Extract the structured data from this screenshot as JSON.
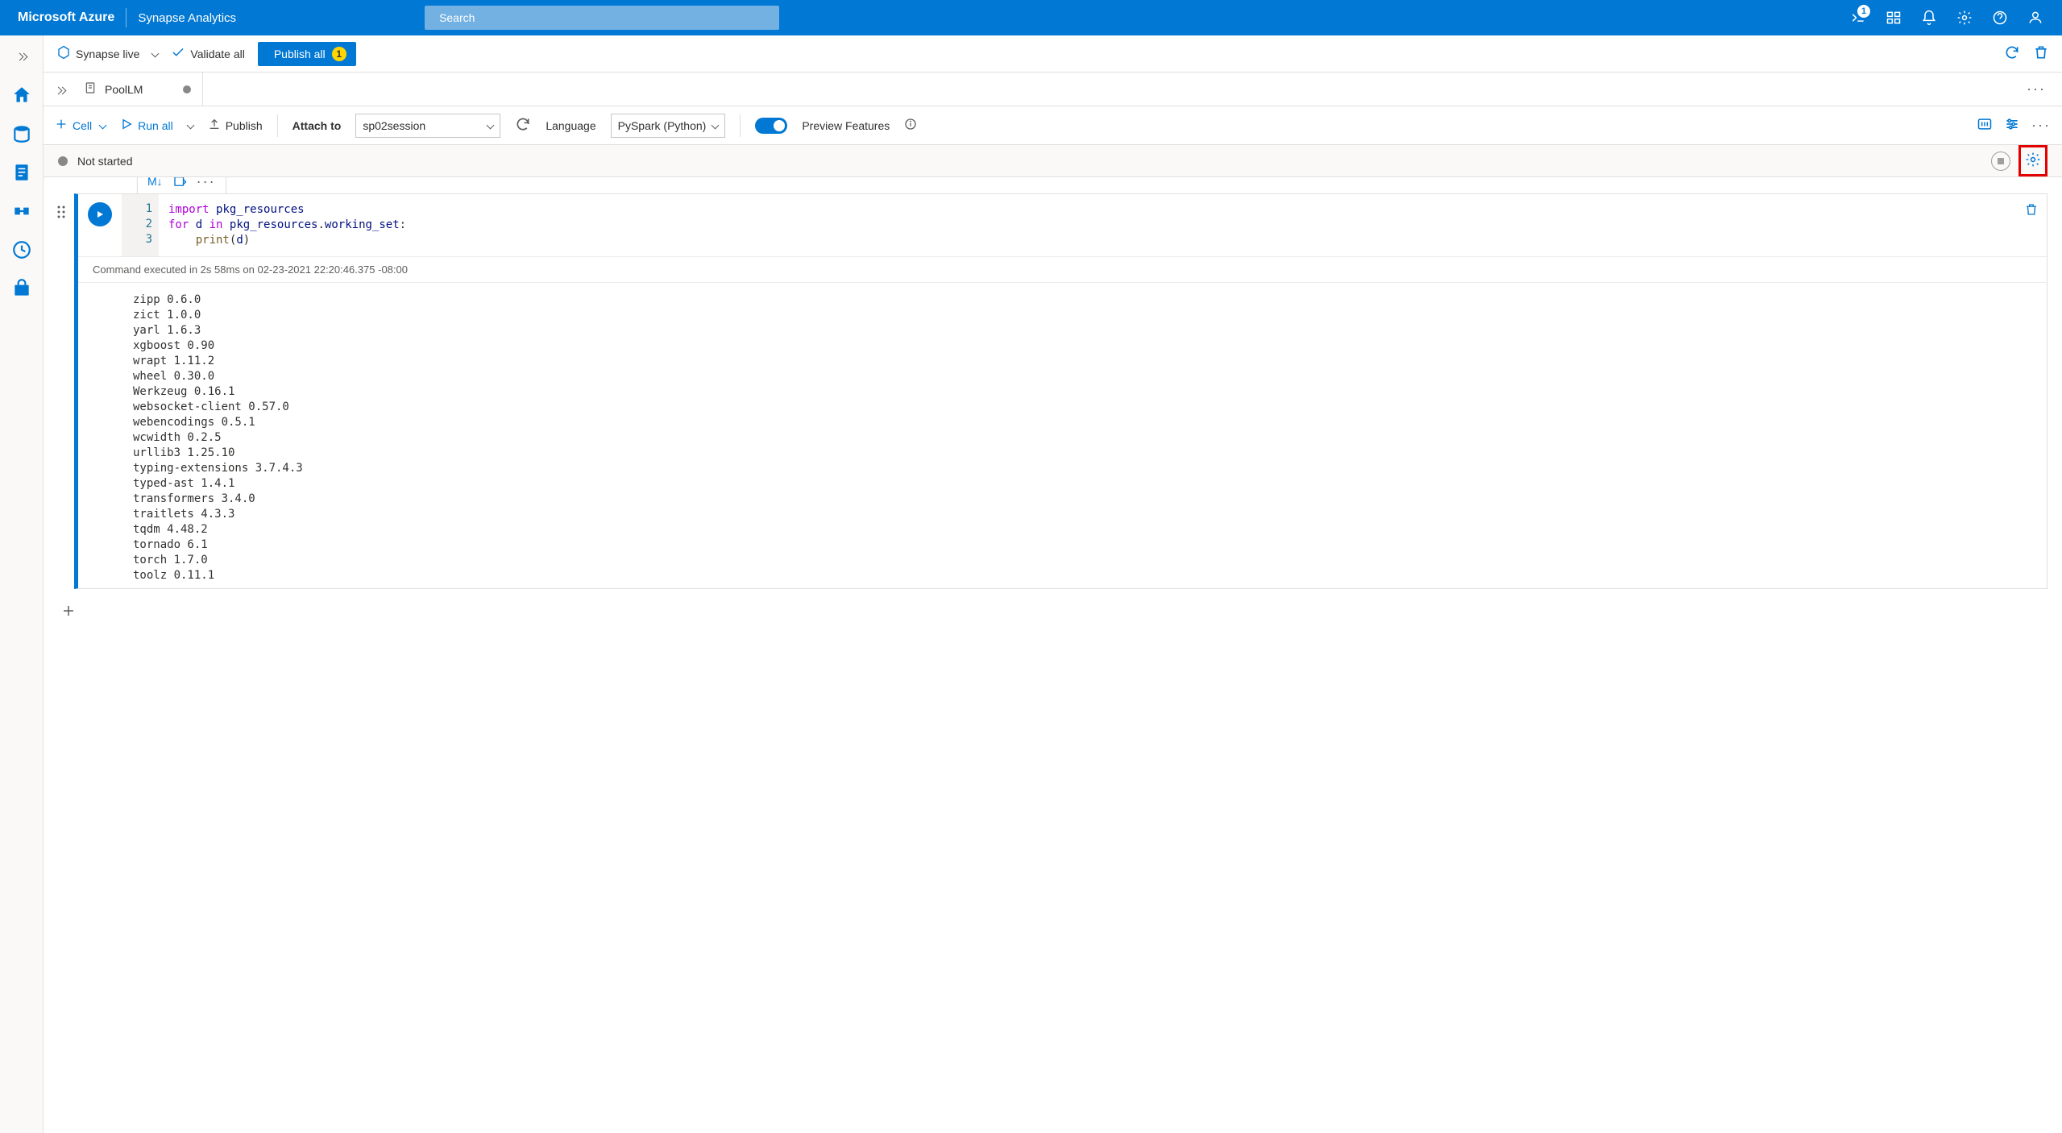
{
  "header": {
    "brand": "Microsoft Azure",
    "product": "Synapse Analytics",
    "search_placeholder": "Search",
    "notif_badge": "1"
  },
  "toolbar": {
    "mode": "Synapse live",
    "validate": "Validate all",
    "publish_all": "Publish all",
    "publish_badge": "1"
  },
  "tab": {
    "name": "PoolLM"
  },
  "nb_toolbar": {
    "cell": "Cell",
    "run_all": "Run all",
    "publish": "Publish",
    "attach_to_label": "Attach to",
    "attach_to_value": "sp02session",
    "language_label": "Language",
    "language_value": "PySpark (Python)",
    "preview": "Preview Features"
  },
  "status": {
    "text": "Not started"
  },
  "cell": {
    "mini_md": "M↓",
    "code_lines": [
      "1",
      "2",
      "3"
    ],
    "code_html": "<span class='tok-kw'>import</span> <span class='tok-id'>pkg_resources</span>\n<span class='tok-kw'>for</span> <span class='tok-id'>d</span> <span class='tok-kw'>in</span> <span class='tok-id'>pkg_resources</span>.<span class='tok-id'>working_set</span>:\n    <span class='tok-fn'>print</span>(<span class='tok-id'>d</span>)",
    "exec_meta": "Command executed in 2s 58ms on 02-23-2021 22:20:46.375 -08:00",
    "output": "zipp 0.6.0\nzict 1.0.0\nyarl 1.6.3\nxgboost 0.90\nwrapt 1.11.2\nwheel 0.30.0\nWerkzeug 0.16.1\nwebsocket-client 0.57.0\nwebencodings 0.5.1\nwcwidth 0.2.5\nurllib3 1.25.10\ntyping-extensions 3.7.4.3\ntyped-ast 1.4.1\ntransformers 3.4.0\ntraitlets 4.3.3\ntqdm 4.48.2\ntornado 6.1\ntorch 1.7.0\ntoolz 0.11.1"
  }
}
